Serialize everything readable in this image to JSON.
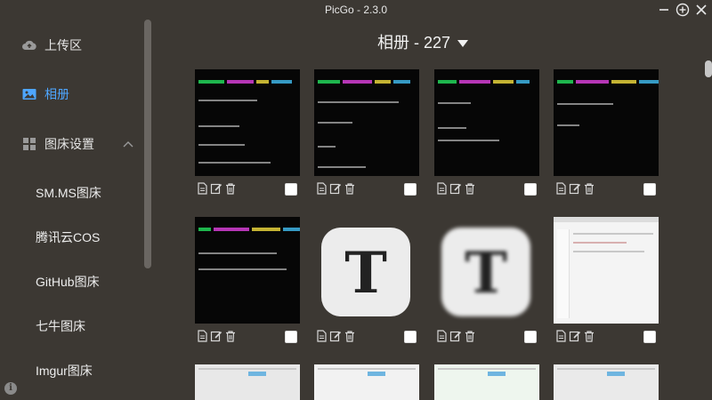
{
  "window": {
    "title": "PicGo - 2.3.0"
  },
  "sidebar": {
    "items": [
      {
        "label": "上传区",
        "icon": "cloud-upload-icon"
      },
      {
        "label": "相册",
        "icon": "image-icon",
        "active": true
      },
      {
        "label": "图床设置",
        "icon": "grid-icon"
      }
    ],
    "sub_items": [
      "SM.MS图床",
      "腾讯云COS",
      "GitHub图床",
      "七牛图床",
      "Imgur图床"
    ]
  },
  "gallery": {
    "title": "相册 - 227",
    "accent": "#4ea6ff",
    "cards": [
      {
        "kind": "terminal"
      },
      {
        "kind": "terminal"
      },
      {
        "kind": "terminal"
      },
      {
        "kind": "terminal"
      },
      {
        "kind": "terminal"
      },
      {
        "kind": "typora-icon"
      },
      {
        "kind": "typora-icon-blurred"
      },
      {
        "kind": "window-screenshot"
      }
    ]
  }
}
